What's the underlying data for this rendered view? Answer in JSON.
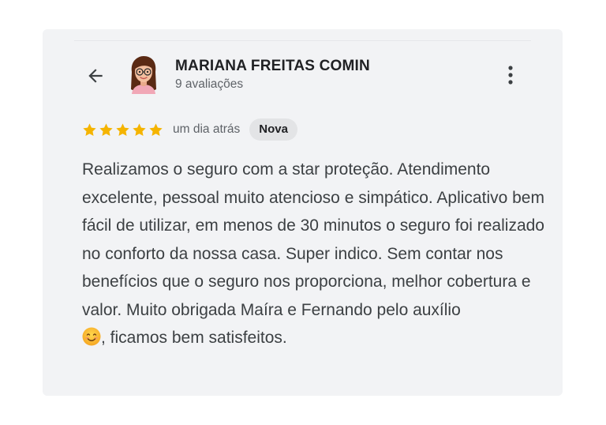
{
  "review": {
    "author_name": "MARIANA FREITAS COMIN",
    "author_review_count": "9 avaliações",
    "rating": 5,
    "rating_max": 5,
    "date": "um dia atrás",
    "badge": "Nova",
    "text_main": "Realizamos o seguro com a star proteção. Atendimento excelente, pessoal muito atencioso e simpático. Aplicativo bem fácil de utilizar, em menos de 30 minutos o seguro foi realizado no conforto da nossa casa. Super indico. Sem contar nos benefícios que o seguro nos proporciona, melhor cobertura e valor. Muito obrigada Maíra e Fernando pelo auxílio",
    "text_end": ", ficamos bem satisfeitos.",
    "emoji": "smiling-face-icon"
  },
  "icons": {
    "back": "arrow-left-icon",
    "more": "more-vert-icon",
    "star": "star-icon"
  },
  "colors": {
    "card_background": "#f2f3f5",
    "star": "#f5b400",
    "badge_background": "#e3e4e6",
    "text_secondary": "#5f6368"
  }
}
